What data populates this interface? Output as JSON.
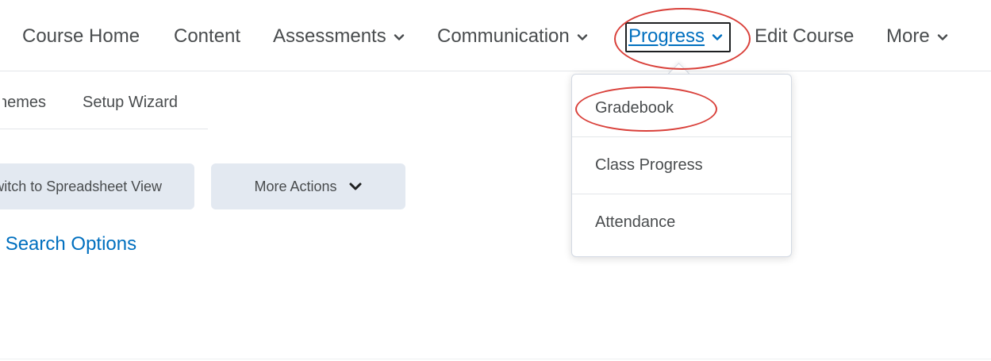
{
  "nav": {
    "items": [
      {
        "label": "Course Home"
      },
      {
        "label": "Content"
      },
      {
        "label": "Assessments"
      },
      {
        "label": "Communication"
      },
      {
        "label": "Progress"
      },
      {
        "label": "Edit Course"
      },
      {
        "label": "More"
      }
    ]
  },
  "subtabs": {
    "items": [
      {
        "label": "Schemes"
      },
      {
        "label": "Setup Wizard"
      }
    ]
  },
  "actions": {
    "spreadsheet_label": "Switch to Spreadsheet View",
    "more_actions_label": "More Actions"
  },
  "search": {
    "options_label": "Show Search Options"
  },
  "progress_menu": {
    "items": [
      {
        "label": "Gradebook"
      },
      {
        "label": "Class Progress"
      },
      {
        "label": "Attendance"
      }
    ]
  },
  "colors": {
    "link": "#006fbf",
    "text": "#494c4e",
    "button_bg": "#e3e9f1",
    "annotation": "#d9403a"
  },
  "icons": {
    "dropdown": "chevron-down-icon"
  }
}
